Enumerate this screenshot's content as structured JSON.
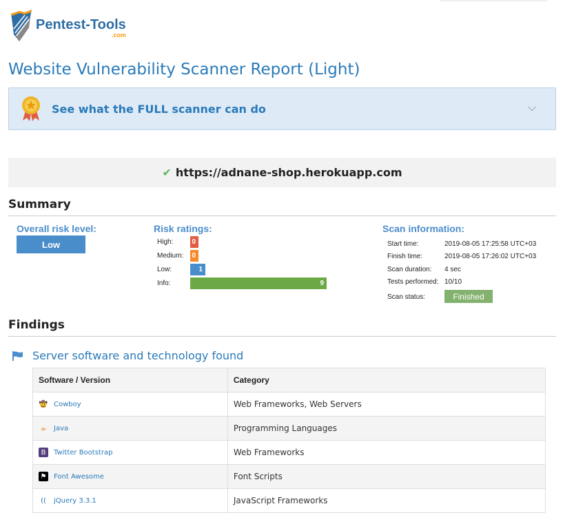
{
  "logo": {
    "name": "Pentest-Tools",
    "suffix": ".com"
  },
  "title": "Website Vulnerability Scanner Report (Light)",
  "promo": {
    "text": "See what the FULL scanner can do"
  },
  "target_url": "https://adnane-shop.herokuapp.com",
  "summary": {
    "heading": "Summary",
    "overall_label": "Overall risk level:",
    "overall_value": "Low",
    "risk_label": "Risk ratings:",
    "ratings": [
      {
        "label": "High:",
        "value": "0",
        "color": "#e05d44"
      },
      {
        "label": "Medium:",
        "value": "0",
        "color": "#f68b2e"
      },
      {
        "label": "Low:",
        "value": "1",
        "color": "#4a8dcb"
      },
      {
        "label": "Info:",
        "value": "9",
        "color": "#6aa946"
      }
    ],
    "scan_label": "Scan information:",
    "scan": [
      {
        "k": "Start time:",
        "v": "2019-08-05 17:25:58 UTC+03"
      },
      {
        "k": "Finish time:",
        "v": "2019-08-05 17:26:02 UTC+03"
      },
      {
        "k": "Scan duration:",
        "v": "4 sec"
      },
      {
        "k": "Tests performed:",
        "v": "10/10"
      },
      {
        "k": "Scan status:",
        "v": "Finished"
      }
    ]
  },
  "findings": {
    "heading": "Findings",
    "subheading": "Server software and technology found",
    "columns": [
      "Software / Version",
      "Category"
    ],
    "rows": [
      {
        "software": "Cowboy",
        "category": "Web Frameworks, Web Servers",
        "icon": "cowboy-icon"
      },
      {
        "software": "Java",
        "category": "Programming Languages",
        "icon": "java-icon"
      },
      {
        "software": "Twitter Bootstrap",
        "category": "Web Frameworks",
        "icon": "bootstrap-icon"
      },
      {
        "software": "Font Awesome",
        "category": "Font Scripts",
        "icon": "font-awesome-icon"
      },
      {
        "software": "jQuery 3.3.1",
        "category": "JavaScript Frameworks",
        "icon": "jquery-icon"
      }
    ]
  }
}
